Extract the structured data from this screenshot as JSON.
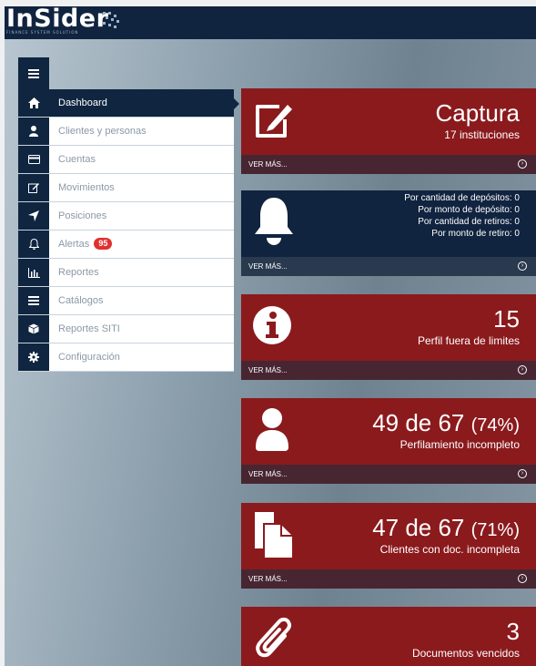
{
  "brand": {
    "name": "InSider",
    "tagline": "FINANCE SYSTEM SOLUTION"
  },
  "sidebar": {
    "items": [
      {
        "label": "Dashboard",
        "icon": "home-icon",
        "active": true
      },
      {
        "label": "Clientes y personas",
        "icon": "user-icon"
      },
      {
        "label": "Cuentas",
        "icon": "credit-card-icon"
      },
      {
        "label": "Movimientos",
        "icon": "edit-icon"
      },
      {
        "label": "Posiciones",
        "icon": "location-arrow-icon"
      },
      {
        "label": "Alertas",
        "icon": "bell-icon",
        "badge": "95"
      },
      {
        "label": "Reportes",
        "icon": "bar-chart-icon"
      },
      {
        "label": "Catálogos",
        "icon": "list-icon"
      },
      {
        "label": "Reportes SITI",
        "icon": "cube-icon"
      },
      {
        "label": "Configuración",
        "icon": "gear-icon"
      }
    ]
  },
  "cards": {
    "captura": {
      "title": "Captura",
      "subtitle": "17 instituciones",
      "link": "VER MÁS...",
      "icon": "edit-icon",
      "color": "#8b1a1d"
    },
    "alertas": {
      "lines": [
        "Por cantidad de depósitos: 0",
        "Por monto de depósito: 0",
        "Por cantidad de retiros: 0",
        "Por monto de retiro: 0"
      ],
      "link": "VER MÁS...",
      "icon": "bell-icon",
      "color": "#10233f"
    },
    "perfil": {
      "value": "15",
      "subtitle": "Perfil fuera de limites",
      "link": "VER MÁS...",
      "icon": "info-icon"
    },
    "perfilamiento": {
      "value": "49 de 67",
      "pct": "(74%)",
      "subtitle": "Perfilamiento incompleto",
      "link": "VER MÁS...",
      "icon": "user-icon"
    },
    "documentacion": {
      "value": "47 de 67",
      "pct": "(71%)",
      "subtitle": "Clientes con doc. incompleta",
      "link": "VER MÁS...",
      "icon": "documents-icon"
    },
    "vencidos": {
      "value": "3",
      "subtitle": "Documentos vencidos",
      "icon": "paperclip-icon"
    }
  }
}
